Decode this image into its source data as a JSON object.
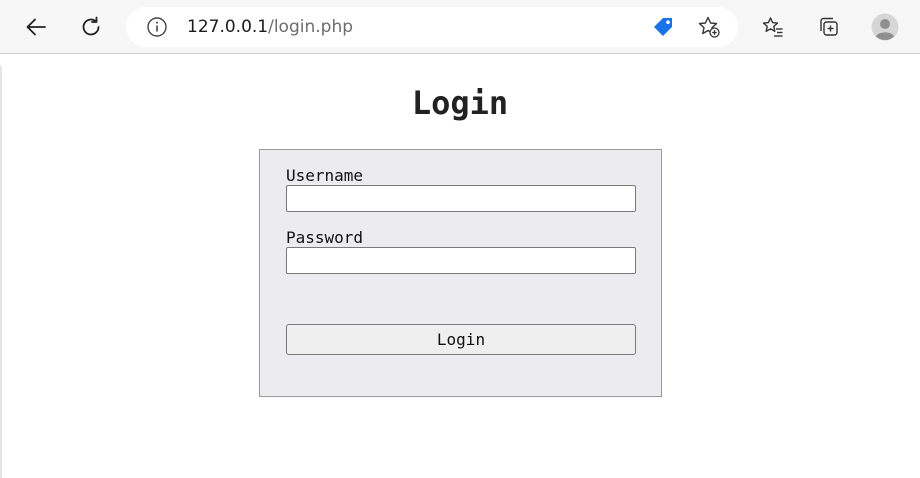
{
  "browser": {
    "url_host": "127.0.0.1",
    "url_path": "/login.php",
    "icons": {
      "back": "back-arrow-icon",
      "refresh": "refresh-icon",
      "info": "info-icon",
      "tag": "price-tag-icon",
      "add_favorite": "add-favorite-icon",
      "favorites": "favorites-icon",
      "collections": "collections-icon",
      "profile": "profile-avatar-icon"
    },
    "accent_color": "#1a73e8"
  },
  "page": {
    "title": "Login"
  },
  "form": {
    "username_label": "Username",
    "username_value": "",
    "password_label": "Password",
    "password_value": "",
    "submit_label": "Login",
    "panel_color": "#ecebef"
  }
}
